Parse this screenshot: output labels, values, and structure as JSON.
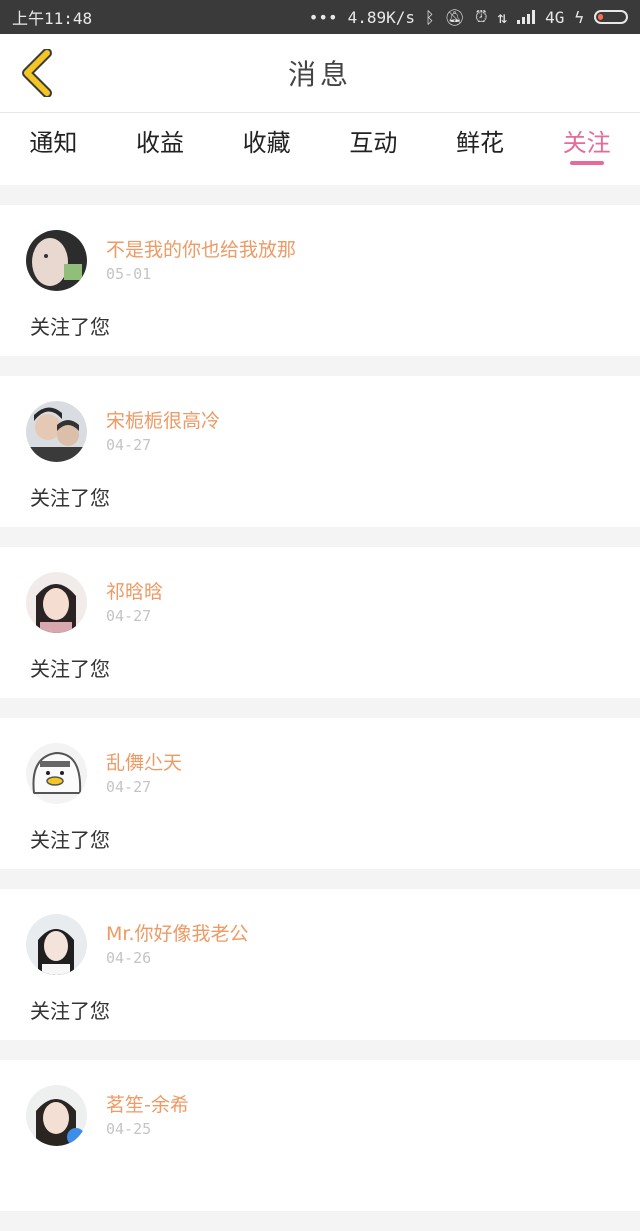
{
  "status_bar": {
    "time": "上午11:48",
    "network_speed": "4.89K/s",
    "network_type": "4G"
  },
  "header": {
    "title": "消息"
  },
  "tabs": [
    {
      "label": "通知",
      "active": false
    },
    {
      "label": "收益",
      "active": false
    },
    {
      "label": "收藏",
      "active": false
    },
    {
      "label": "互动",
      "active": false
    },
    {
      "label": "鲜花",
      "active": false
    },
    {
      "label": "关注",
      "active": true
    }
  ],
  "messages": [
    {
      "name": "不是我的你也给我放那",
      "date": "05-01",
      "text": "关注了您"
    },
    {
      "name": "宋栀栀很高冷",
      "date": "04-27",
      "text": "关注了您"
    },
    {
      "name": "祁晗晗",
      "date": "04-27",
      "text": "关注了您"
    },
    {
      "name": "乱儛尐天",
      "date": "04-27",
      "text": "关注了您"
    },
    {
      "name": "Mr.你好像我老公",
      "date": "04-26",
      "text": "关注了您"
    },
    {
      "name": "茗笙-余希",
      "date": "04-25",
      "text": ""
    }
  ],
  "colors": {
    "accent_pink": "#e86a9b",
    "name_orange": "#ef9a64",
    "back_yellow": "#f3c623"
  }
}
